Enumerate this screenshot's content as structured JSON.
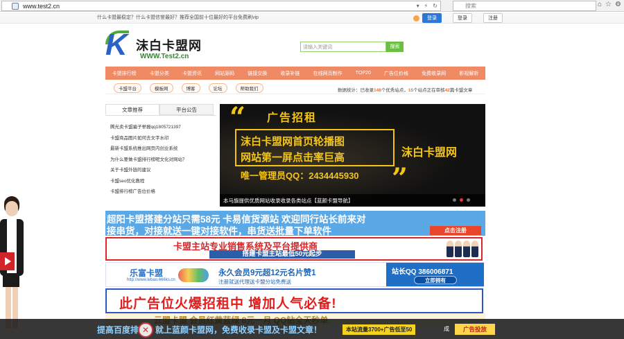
{
  "browser": {
    "url": "www.test2.cn",
    "search_placeholder": "搜索"
  },
  "topbar": {
    "notice": "什么卡盟最稳定？什么卡盟信誉最好？推荐全国前十位最好的平台免费刷vip",
    "login_btn": "登录",
    "login_label": "登录",
    "register_label": "注册"
  },
  "header": {
    "logo_name": "沫白卡盟网",
    "logo_domain": "WWW.Test2.cn",
    "search_placeholder": "请输入关键词",
    "search_btn": "搜索"
  },
  "nav": [
    "卡盟排行榜",
    "卡盟分类",
    "卡盟资讯",
    "网站源码",
    "链接交换",
    "收录补链",
    "在线网页制作",
    "TOP20",
    "广告位价格",
    "免费收录网",
    "影视解析"
  ],
  "subnav": [
    "卡盟平台",
    "模板网",
    "博客",
    "论坛",
    "帮助我们"
  ],
  "stats": {
    "prefix": "数据统计：已收录",
    "sites": "148",
    "mid1": "个优秀站点，",
    "pending": "15",
    "mid2": "个站点正在审核",
    "articles": "42",
    "suffix": "篇卡盟文章"
  },
  "left_panel": {
    "tab_active": "文章推荐",
    "tab_other": "平台公告",
    "items": [
      "腾光卖卡盟骗子举报qq1805721397",
      "卡盟商品图片如何去文字水印",
      "最新卡盟系统推出网页内创业系统",
      "为什么要做卡盟排行榜呢文化对网站？",
      "关于卡盟外链的建议",
      "卡盟seo优化教程",
      "卡盟排行榜广告位价格"
    ]
  },
  "carousel": {
    "title": "广告招租",
    "line1": "沫白卡盟网首页轮播图",
    "line2": "网站第一屏点击率巨高",
    "qq": "唯一管理员QQ：2434445930",
    "brand": "沫白卡盟网",
    "caption": "本马旗提供优质网站收录收录各类站点【蓝颜卡盟导航】"
  },
  "banner1": {
    "line1": "超阳卡盟搭建分站只需58元  卡易信货源站 欢迎同行站长前来对",
    "line2": "接串货，对接就送一键对接软件，串货送批量下单软件",
    "btn": "点击注册"
  },
  "banner2": {
    "line1": "卡盟主站专业销售系统及平台提供商",
    "line2": "搭建卡盟主站最低50元起步"
  },
  "banner3": {
    "logo": "乐富卡盟",
    "logo_sub": "http://www.lebao.666ks.cn",
    "mid": "永久会员9元超12元名片赞1",
    "mid_sub": "注册就送代理送卡盟分站免费送",
    "qq": "站长QQ 386006871",
    "btn": "立即拥有"
  },
  "banner4": {
    "text": "此广告位火爆招租中  增加人气必备!"
  },
  "banner5": {
    "text": "云盟卡盟 会员红黄蓝绿 8元一月  QQ钻全天秒单"
  },
  "bottom_bar": {
    "text": "提高百度排名，就上蓝颜卡盟网，免费收录卡盟及卡盟文章！",
    "tag": "本站流量3700+广告低至50",
    "tail": "成",
    "ad_btn": "广告投放"
  },
  "colors": {
    "nav": "#f08a64",
    "accent_green": "#6cbf43",
    "carousel_text": "#f3c519"
  }
}
